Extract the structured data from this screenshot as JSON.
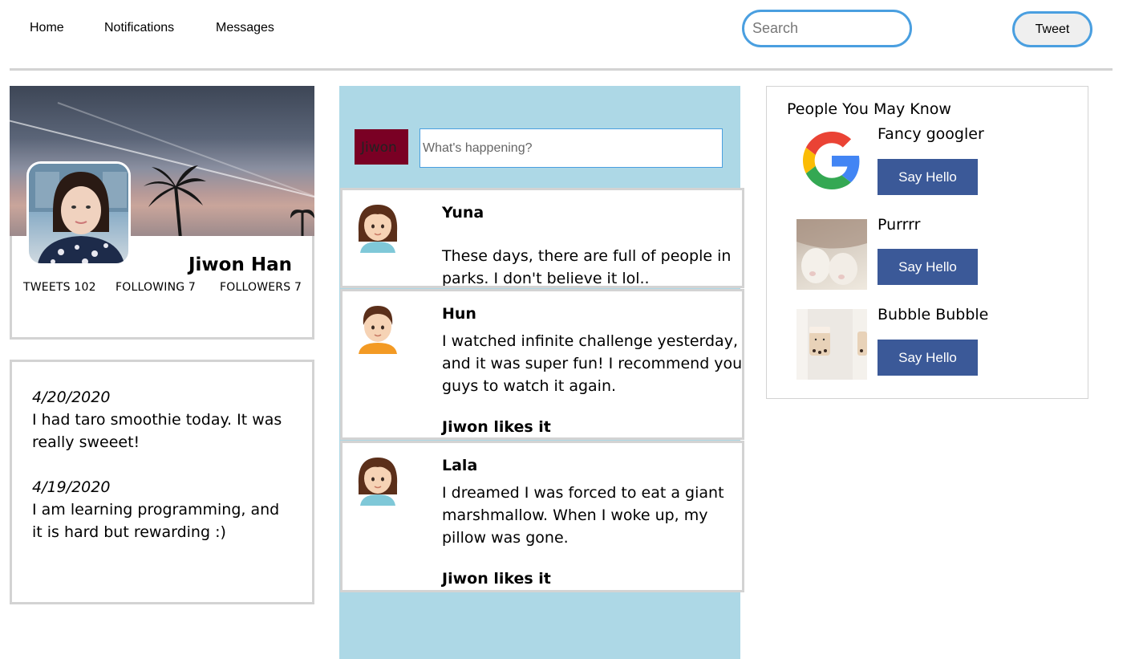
{
  "nav": {
    "home": "Home",
    "notifications": "Notifications",
    "messages": "Messages",
    "search_placeholder": "Search",
    "tweet_button": "Tweet"
  },
  "profile": {
    "name": "Jiwon Han",
    "tweets": "TWEETS 102",
    "following": "FOLLOWING 7",
    "followers": "FOLLOWERS 7"
  },
  "diary": [
    {
      "date": "4/20/2020",
      "text": "I had taro smoothie today. It was really sweeet!"
    },
    {
      "date": "4/19/2020",
      "text": "I am learning programming, and it is hard but rewarding :)"
    }
  ],
  "compose": {
    "avatar_label": "Jiwon",
    "placeholder": "What's happening?"
  },
  "tweets": [
    {
      "author": "Yuna",
      "text": "These days, there are full of people in parks. I don't believe it lol..",
      "likes": ""
    },
    {
      "author": "Hun",
      "text": "I watched infinite challenge yesterday, and it was super fun! I recommend you guys to watch it again.",
      "likes": "Jiwon likes it"
    },
    {
      "author": "Lala",
      "text": "I dreamed I was forced to eat a giant marshmallow. When I woke up, my pillow was gone.",
      "likes": "Jiwon likes it"
    }
  ],
  "pymk": {
    "title": "People You May Know",
    "people": [
      {
        "name": "Fancy googler",
        "button": "Say Hello"
      },
      {
        "name": "Purrrr",
        "button": "Say Hello"
      },
      {
        "name": "Bubble Bubble",
        "button": "Say Hello"
      }
    ]
  },
  "colors": {
    "feed_bg": "#add8e6",
    "button_blue": "#3b5998",
    "accent_blue": "#4a9fe0",
    "compose_avatar": "#7a0024"
  }
}
